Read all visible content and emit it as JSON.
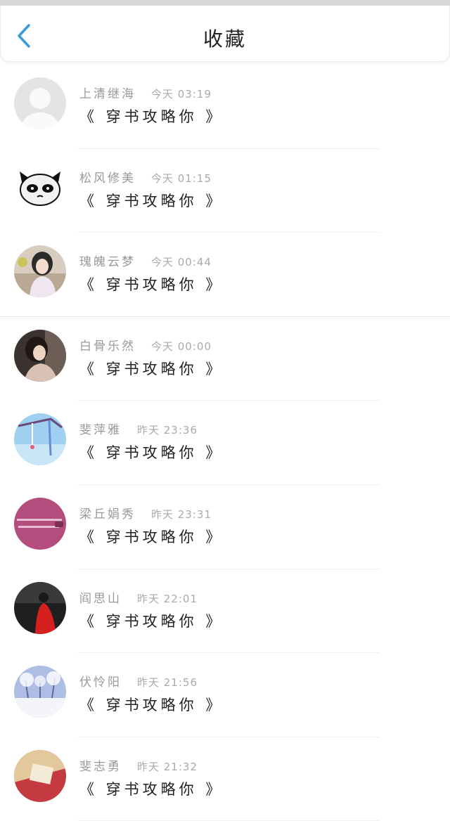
{
  "header": {
    "title": "收藏",
    "back_icon": "chevron-left-icon"
  },
  "colors": {
    "accent": "#3a9bdc"
  },
  "items": [
    {
      "name": "上清继海",
      "time": "今天 03:19",
      "book": "《 穿书攻略你 》",
      "avatar": "default-avatar"
    },
    {
      "name": "松风修美",
      "time": "今天 01:15",
      "book": "《 穿书攻略你 》",
      "avatar": "panda-cat-avatar"
    },
    {
      "name": "瑰魄云梦",
      "time": "今天 00:44",
      "book": "《 穿书攻略你 》",
      "avatar": "girl-portrait-avatar"
    },
    {
      "name": "白骨乐然",
      "time": "今天 00:00",
      "book": "《 穿书攻略你 》",
      "avatar": "woman-photo-avatar"
    },
    {
      "name": "斐萍雅",
      "time": "昨天 23:36",
      "book": "《 穿书攻略你 》",
      "avatar": "sky-windchime-avatar"
    },
    {
      "name": "梁丘娟秀",
      "time": "昨天 23:31",
      "book": "《 穿书攻略你 》",
      "avatar": "pink-text-avatar"
    },
    {
      "name": "阎思山",
      "time": "昨天 22:01",
      "book": "《 穿书攻略你 》",
      "avatar": "red-dress-avatar"
    },
    {
      "name": "伏怜阳",
      "time": "昨天 21:56",
      "book": "《 穿书攻略你 》",
      "avatar": "snow-tree-avatar"
    },
    {
      "name": "斐志勇",
      "time": "昨天 21:32",
      "book": "《 穿书攻略你 》",
      "avatar": "red-envelope-avatar"
    }
  ]
}
